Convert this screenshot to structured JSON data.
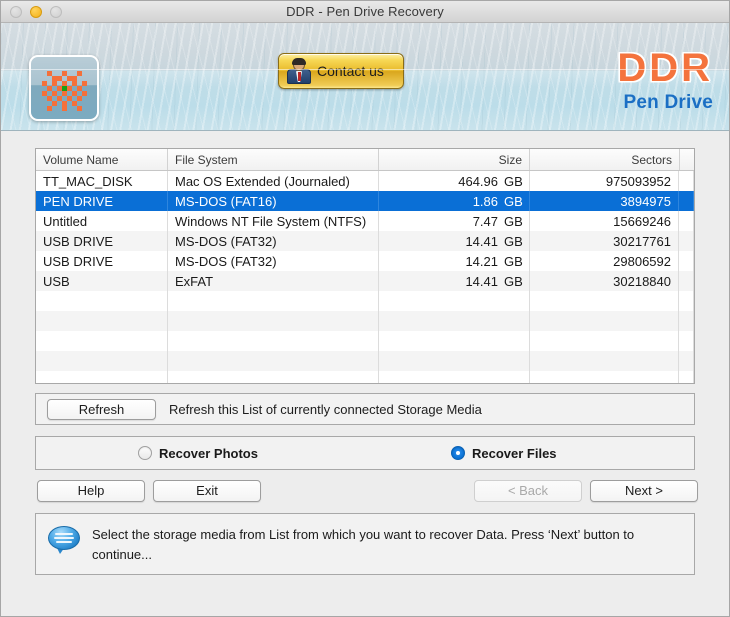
{
  "window": {
    "title": "DDR - Pen Drive Recovery",
    "traffic": {
      "close": "close-button",
      "minimize": "minimize-button",
      "maximize": "maximize-button"
    }
  },
  "header": {
    "app_icon_name": "app-icon",
    "contact_button": "Contact us",
    "brand_main": "DDR",
    "brand_sub": "Pen Drive",
    "brand_color": "#f4733d",
    "brand_sub_color": "#1b6fc4"
  },
  "table": {
    "columns": [
      {
        "label": "Volume Name",
        "align": "left"
      },
      {
        "label": "File System",
        "align": "left"
      },
      {
        "label": "Size",
        "align": "right"
      },
      {
        "label": "Sectors",
        "align": "right"
      }
    ],
    "rows": [
      {
        "volume": "TT_MAC_DISK",
        "filesystem": "Mac OS Extended (Journaled)",
        "size": "464.96",
        "unit": "GB",
        "sectors": "975093952",
        "selected": false
      },
      {
        "volume": "PEN DRIVE",
        "filesystem": "MS-DOS (FAT16)",
        "size": "1.86",
        "unit": "GB",
        "sectors": "3894975",
        "selected": true
      },
      {
        "volume": "Untitled",
        "filesystem": "Windows NT File System (NTFS)",
        "size": "7.47",
        "unit": "GB",
        "sectors": "15669246",
        "selected": false
      },
      {
        "volume": "USB DRIVE",
        "filesystem": "MS-DOS (FAT32)",
        "size": "14.41",
        "unit": "GB",
        "sectors": "30217761",
        "selected": false
      },
      {
        "volume": "USB DRIVE",
        "filesystem": "MS-DOS (FAT32)",
        "size": "14.21",
        "unit": "GB",
        "sectors": "29806592",
        "selected": false
      },
      {
        "volume": "USB",
        "filesystem": "ExFAT",
        "size": "14.41",
        "unit": "GB",
        "sectors": "30218840",
        "selected": false
      },
      {
        "volume": "",
        "filesystem": "",
        "size": "",
        "unit": "",
        "sectors": "",
        "selected": false
      },
      {
        "volume": "",
        "filesystem": "",
        "size": "",
        "unit": "",
        "sectors": "",
        "selected": false
      },
      {
        "volume": "",
        "filesystem": "",
        "size": "",
        "unit": "",
        "sectors": "",
        "selected": false
      },
      {
        "volume": "",
        "filesystem": "",
        "size": "",
        "unit": "",
        "sectors": "",
        "selected": false
      },
      {
        "volume": "",
        "filesystem": "",
        "size": "",
        "unit": "",
        "sectors": "",
        "selected": false
      }
    ],
    "selection_color": "#0a6fd6"
  },
  "refresh": {
    "button_label": "Refresh",
    "description": "Refresh this List of currently connected Storage Media"
  },
  "mode": {
    "options": [
      {
        "label": "Recover Photos",
        "selected": false
      },
      {
        "label": "Recover Files",
        "selected": true
      }
    ]
  },
  "nav": {
    "help": "Help",
    "exit": "Exit",
    "back": "< Back",
    "back_disabled": true,
    "next": "Next >"
  },
  "info": {
    "icon_name": "speech-bubble-icon",
    "message": "Select the storage media from List from which you want to recover Data. Press ‘Next’ button to continue..."
  }
}
